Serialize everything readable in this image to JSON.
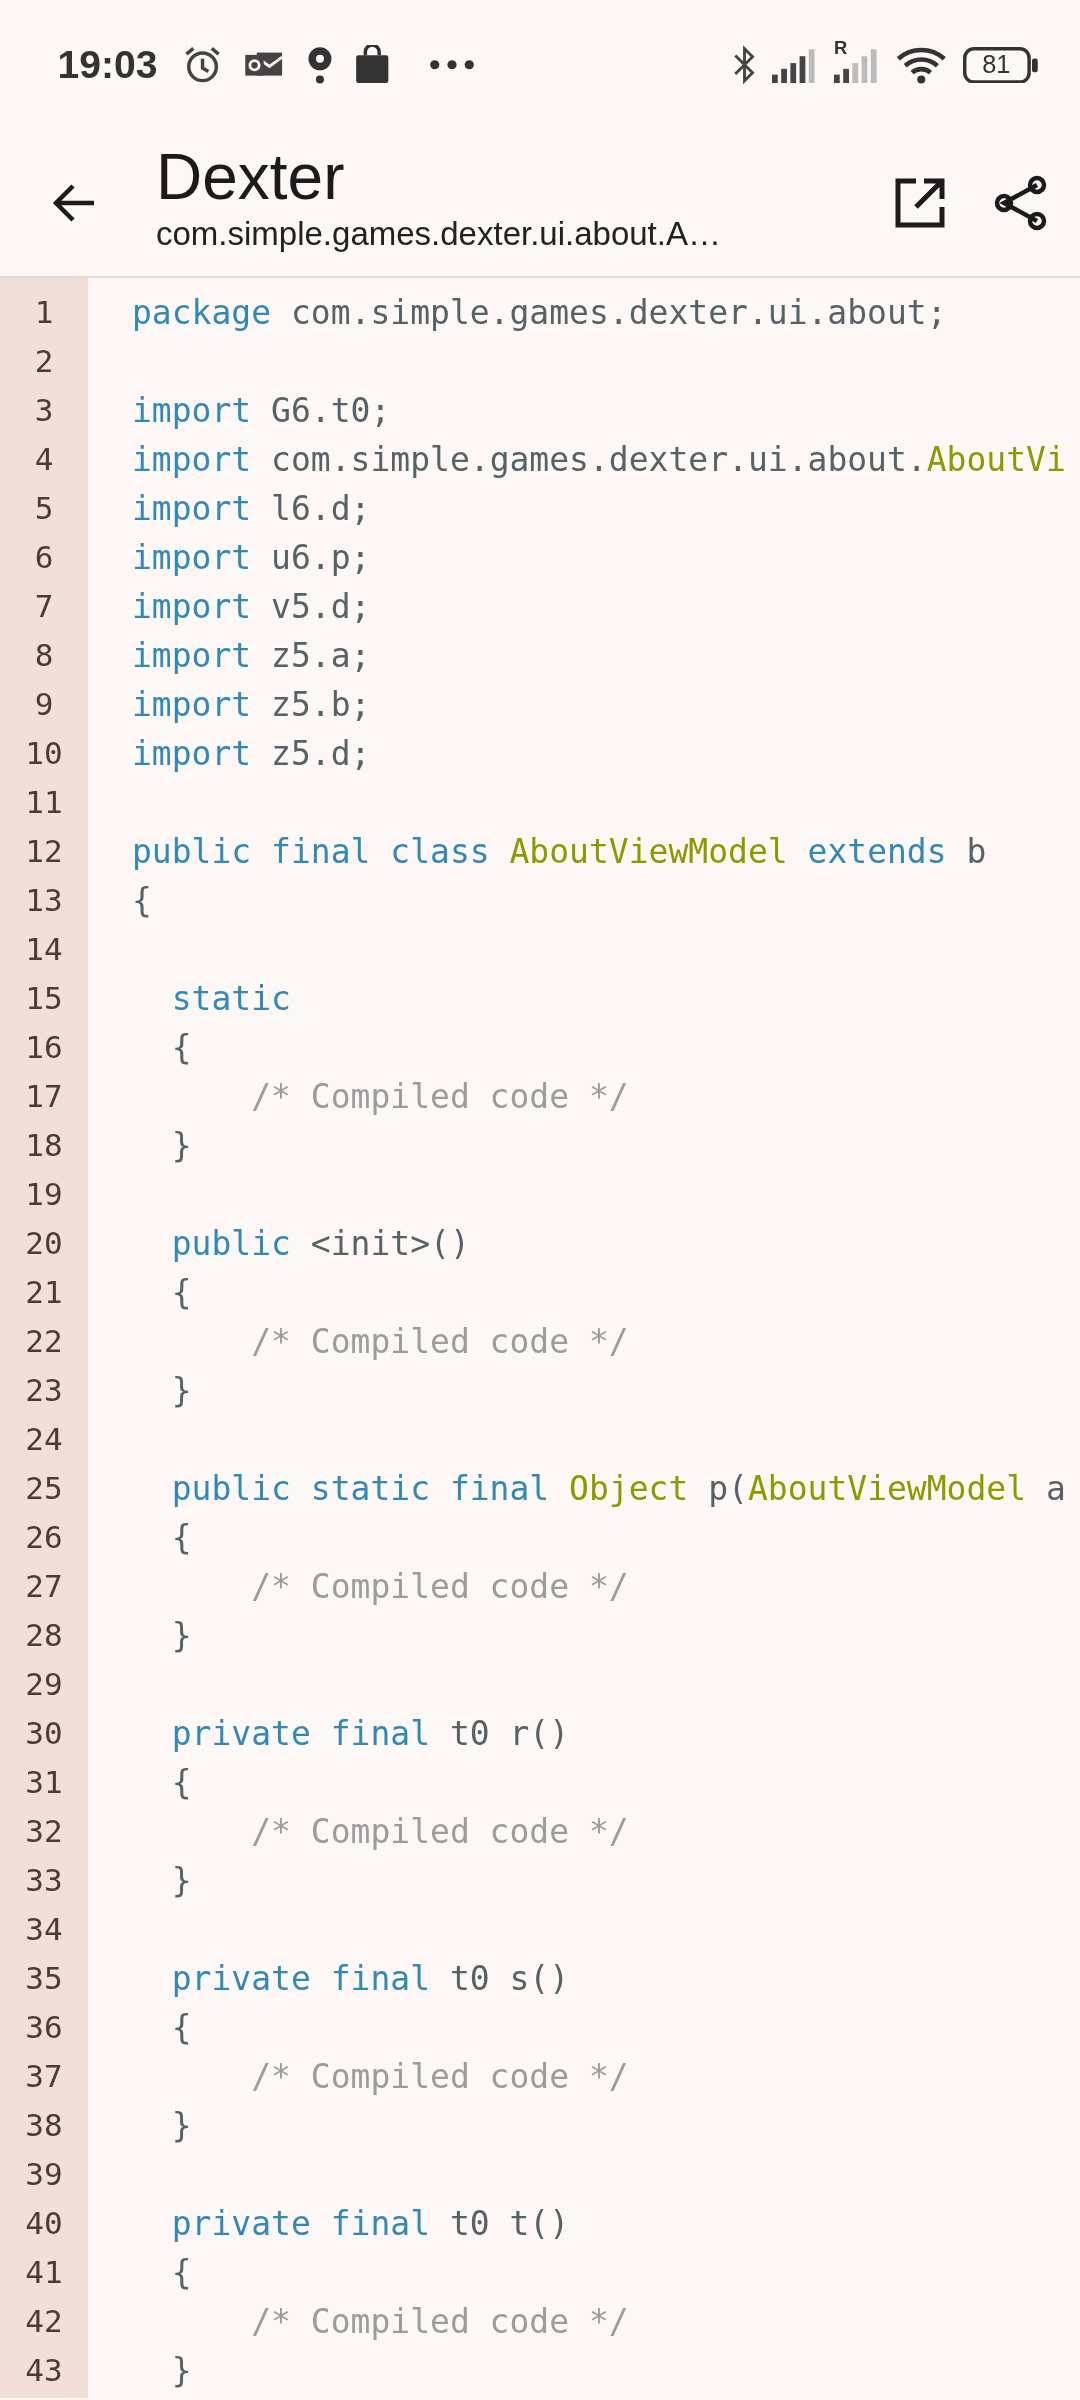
{
  "status_bar": {
    "time": "19:03",
    "roaming_label": "R",
    "battery": "81"
  },
  "app_bar": {
    "title": "Dexter",
    "subtitle": "com.simple.games.dexter.ui.about.A…"
  },
  "code": {
    "lines": [
      {
        "number": "1",
        "tokens": [
          {
            "kind": "keyword",
            "text": "package"
          },
          {
            "kind": "plain",
            "text": " com.simple.games.dexter.ui.about;"
          }
        ]
      },
      {
        "number": "2"
      },
      {
        "number": "3",
        "tokens": [
          {
            "kind": "keyword",
            "text": "import"
          },
          {
            "kind": "plain",
            "text": " G6.t0;"
          }
        ]
      },
      {
        "number": "4",
        "tokens": [
          {
            "kind": "keyword",
            "text": "import"
          },
          {
            "kind": "plain",
            "text": " com.simple.games.dexter.ui.about."
          },
          {
            "kind": "type",
            "text": "AboutVi"
          }
        ]
      },
      {
        "number": "5",
        "tokens": [
          {
            "kind": "keyword",
            "text": "import"
          },
          {
            "kind": "plain",
            "text": " l6.d;"
          }
        ]
      },
      {
        "number": "6",
        "tokens": [
          {
            "kind": "keyword",
            "text": "import"
          },
          {
            "kind": "plain",
            "text": " u6.p;"
          }
        ]
      },
      {
        "number": "7",
        "tokens": [
          {
            "kind": "keyword",
            "text": "import"
          },
          {
            "kind": "plain",
            "text": " v5.d;"
          }
        ]
      },
      {
        "number": "8",
        "tokens": [
          {
            "kind": "keyword",
            "text": "import"
          },
          {
            "kind": "plain",
            "text": " z5.a;"
          }
        ]
      },
      {
        "number": "9",
        "tokens": [
          {
            "kind": "keyword",
            "text": "import"
          },
          {
            "kind": "plain",
            "text": " z5.b;"
          }
        ]
      },
      {
        "number": "10",
        "tokens": [
          {
            "kind": "keyword",
            "text": "import"
          },
          {
            "kind": "plain",
            "text": " z5.d;"
          }
        ]
      },
      {
        "number": "11"
      },
      {
        "number": "12",
        "tokens": [
          {
            "kind": "keyword",
            "text": "public final class "
          },
          {
            "kind": "type",
            "text": "AboutViewModel"
          },
          {
            "kind": "keyword",
            "text": " extends"
          },
          {
            "kind": "plain",
            "text": " b"
          }
        ]
      },
      {
        "number": "13",
        "tokens": [
          {
            "kind": "plain",
            "text": "{"
          }
        ]
      },
      {
        "number": "14"
      },
      {
        "number": "15",
        "tokens": [
          {
            "kind": "keyword",
            "text": "  static"
          }
        ]
      },
      {
        "number": "16",
        "tokens": [
          {
            "kind": "plain",
            "text": "  {"
          }
        ]
      },
      {
        "number": "17",
        "tokens": [
          {
            "kind": "comment",
            "text": "      /* Compiled code */"
          }
        ]
      },
      {
        "number": "18",
        "tokens": [
          {
            "kind": "plain",
            "text": "  }"
          }
        ]
      },
      {
        "number": "19"
      },
      {
        "number": "20",
        "tokens": [
          {
            "kind": "keyword",
            "text": "  public"
          },
          {
            "kind": "plain",
            "text": " <init>()"
          }
        ]
      },
      {
        "number": "21",
        "tokens": [
          {
            "kind": "plain",
            "text": "  {"
          }
        ]
      },
      {
        "number": "22",
        "tokens": [
          {
            "kind": "comment",
            "text": "      /* Compiled code */"
          }
        ]
      },
      {
        "number": "23",
        "tokens": [
          {
            "kind": "plain",
            "text": "  }"
          }
        ]
      },
      {
        "number": "24"
      },
      {
        "number": "25",
        "tokens": [
          {
            "kind": "keyword",
            "text": "  public static final "
          },
          {
            "kind": "type",
            "text": "Object"
          },
          {
            "kind": "plain",
            "text": " p("
          },
          {
            "kind": "type",
            "text": "AboutViewModel"
          },
          {
            "kind": "plain",
            "text": " a"
          }
        ]
      },
      {
        "number": "26",
        "tokens": [
          {
            "kind": "plain",
            "text": "  {"
          }
        ]
      },
      {
        "number": "27",
        "tokens": [
          {
            "kind": "comment",
            "text": "      /* Compiled code */"
          }
        ]
      },
      {
        "number": "28",
        "tokens": [
          {
            "kind": "plain",
            "text": "  }"
          }
        ]
      },
      {
        "number": "29"
      },
      {
        "number": "30",
        "tokens": [
          {
            "kind": "keyword",
            "text": "  private final"
          },
          {
            "kind": "plain",
            "text": " t0 r()"
          }
        ]
      },
      {
        "number": "31",
        "tokens": [
          {
            "kind": "plain",
            "text": "  {"
          }
        ]
      },
      {
        "number": "32",
        "tokens": [
          {
            "kind": "comment",
            "text": "      /* Compiled code */"
          }
        ]
      },
      {
        "number": "33",
        "tokens": [
          {
            "kind": "plain",
            "text": "  }"
          }
        ]
      },
      {
        "number": "34"
      },
      {
        "number": "35",
        "tokens": [
          {
            "kind": "keyword",
            "text": "  private final"
          },
          {
            "kind": "plain",
            "text": " t0 s()"
          }
        ]
      },
      {
        "number": "36",
        "tokens": [
          {
            "kind": "plain",
            "text": "  {"
          }
        ]
      },
      {
        "number": "37",
        "tokens": [
          {
            "kind": "comment",
            "text": "      /* Compiled code */"
          }
        ]
      },
      {
        "number": "38",
        "tokens": [
          {
            "kind": "plain",
            "text": "  }"
          }
        ]
      },
      {
        "number": "39"
      },
      {
        "number": "40",
        "tokens": [
          {
            "kind": "keyword",
            "text": "  private final"
          },
          {
            "kind": "plain",
            "text": " t0 t()"
          }
        ]
      },
      {
        "number": "41",
        "tokens": [
          {
            "kind": "plain",
            "text": "  {"
          }
        ]
      },
      {
        "number": "42",
        "tokens": [
          {
            "kind": "comment",
            "text": "      /* Compiled code */"
          }
        ]
      },
      {
        "number": "43",
        "tokens": [
          {
            "kind": "plain",
            "text": "  }"
          }
        ]
      }
    ]
  }
}
